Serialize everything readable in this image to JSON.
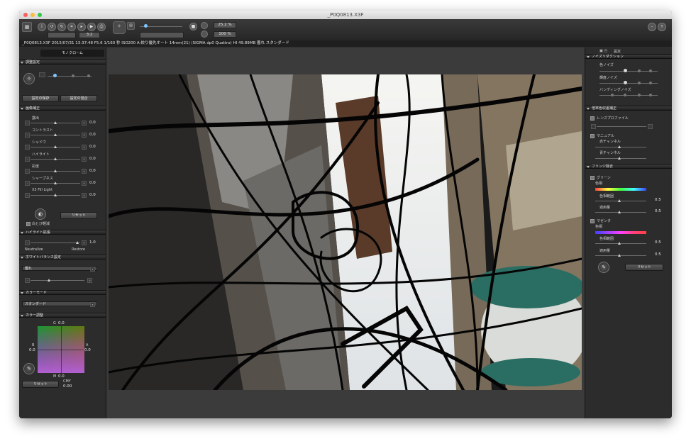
{
  "window": {
    "title": "_P0Q0813.X3F"
  },
  "colors": {
    "close": "#fc605c",
    "minimize": "#fdbc40",
    "zoom": "#34c84a"
  },
  "toolbar": {
    "crop_ratio": "3:2",
    "zoom_percent": "25.2 %",
    "zoom_100": "100 %"
  },
  "infobar": {
    "text": "_P0Q0813.X3F 2015/07/31 13:37:48 F5.6 1/160 秒 ISO200 A-絞り優先オート 14mm(21) (SIGMA dp0 Quattro) HI 49.89MB 曇れ スタンダード"
  },
  "left": {
    "mono_tab": "モノクローム",
    "adjust_header": "調整設定",
    "save_btn": "設定の保存",
    "mix_btn": "設定の混合",
    "image_header": "画像補正",
    "sliders": [
      {
        "label": "露出",
        "value": "0.0"
      },
      {
        "label": "コントラスト",
        "value": "0.0"
      },
      {
        "label": "シャドウ",
        "value": "0.0"
      },
      {
        "label": "ハイライト",
        "value": "0.0"
      },
      {
        "label": "彩度",
        "value": "0.0"
      },
      {
        "label": "シャープネス",
        "value": "0.0"
      },
      {
        "label": "X3 Fill Light",
        "value": "0.0"
      }
    ],
    "reset_btn": "リセット",
    "whiteout_label": "白とび軽減",
    "highlight_header": "ハイライト拡張",
    "highlight_value": "1.0",
    "neutralize": "Neutralize",
    "restore": "Restore",
    "wb_header": "ホワイトバランス設定",
    "wb_value": "曇れ",
    "colormode_header": "カラーモード",
    "colormode_value": "スタンダード",
    "coloradj_header": "カラー調整",
    "g_label": "G",
    "g_val": "0.0",
    "b_label": "B",
    "b_val": "0.0",
    "a_label": "A",
    "a_val": "0.0",
    "m_label": "M",
    "m_val": "0.0",
    "reset2_btn": "リセット",
    "cmy_label": "CMY",
    "cmy_val": "0.00"
  },
  "right": {
    "top_label": "設定",
    "noise_header": "ノイズリダクション",
    "color_noise": "色ノイズ",
    "lum_noise": "輝度ノイズ",
    "banding_noise": "バンディングノイズ",
    "ca_header": "倍率色収差補正",
    "lens_profile": "レンズプロファイル",
    "manual": "マニュアル",
    "red_channel": "赤チャンネル",
    "blue_channel": "青チャンネル",
    "fringe_header": "フリンジ除去",
    "green": "グリーン",
    "hue": "色相",
    "hue_range": "色相範囲",
    "amount": "適用量",
    "magenta": "マゼンタ",
    "hue2": "色相",
    "hue_range2": "色相範囲",
    "amount2": "適用量",
    "v1": "0.5",
    "v2": "0.5",
    "v3": "0.5",
    "v4": "0.5",
    "reset_btn": "リセット"
  }
}
